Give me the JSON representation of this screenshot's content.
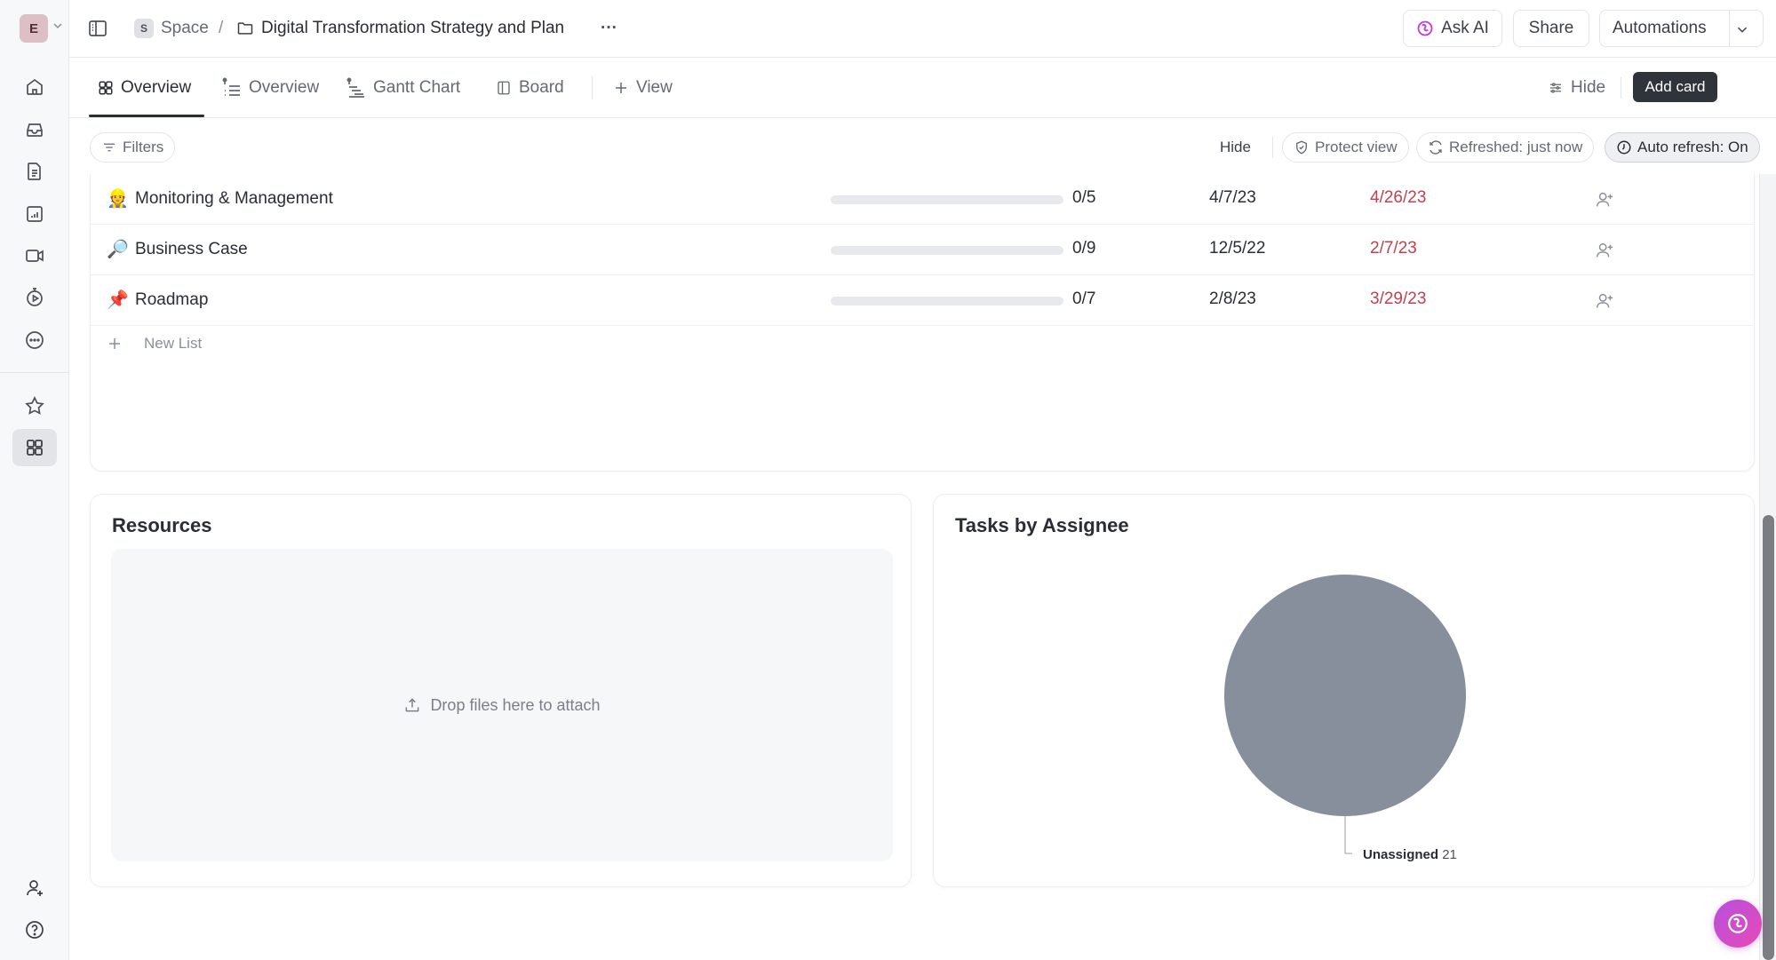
{
  "workspace": {
    "initial": "E"
  },
  "breadcrumb": {
    "space_badge": "S",
    "space": "Space",
    "separator": "/",
    "folder": "Digital Transformation Strategy and Plan",
    "more": "···"
  },
  "header_buttons": {
    "ask_ai": "Ask AI",
    "share": "Share",
    "automations": "Automations"
  },
  "tabs": [
    {
      "label": "Overview",
      "icon": "dashboard-grid-icon",
      "active": true
    },
    {
      "label": "Overview",
      "icon": "pinned-list-icon",
      "active": false
    },
    {
      "label": "Gantt Chart",
      "icon": "pinned-gantt-icon",
      "active": false
    },
    {
      "label": "Board",
      "icon": "board-icon",
      "active": false
    }
  ],
  "add_view_label": "View",
  "tabbar_actions": {
    "hide": "Hide",
    "add_card": "Add card"
  },
  "filters": {
    "filters_label": "Filters",
    "hide_label": "Hide",
    "protect_view": "Protect view",
    "refreshed": "Refreshed: just now",
    "auto_refresh": "Auto refresh: On"
  },
  "lists": [
    {
      "emoji": "👷",
      "name": "Monitoring & Management",
      "done": 0,
      "total": 5,
      "progress_label": "0/5",
      "start": "4/7/23",
      "due": "4/26/23"
    },
    {
      "emoji": "🔎",
      "name": "Business Case",
      "done": 0,
      "total": 9,
      "progress_label": "0/9",
      "start": "12/5/22",
      "due": "2/7/23"
    },
    {
      "emoji": "📌",
      "name": "Roadmap",
      "done": 0,
      "total": 7,
      "progress_label": "0/7",
      "start": "2/8/23",
      "due": "3/29/23"
    }
  ],
  "new_list_label": "New List",
  "resources": {
    "title": "Resources",
    "drop_text": "Drop files here to attach"
  },
  "tasks_by_assignee": {
    "title": "Tasks by Assignee"
  },
  "chart_data": {
    "type": "pie",
    "title": "Tasks by Assignee",
    "labels": [
      "Unassigned"
    ],
    "values": [
      21
    ],
    "colors": [
      "#878f9c"
    ],
    "legend": "none",
    "data_labels": [
      {
        "label": "Unassigned",
        "value": "21"
      }
    ]
  },
  "colors": {
    "due_overdue": "#c2404f",
    "accent_dark": "#2a2e34",
    "fab_gradient_start": "#b84fe0",
    "fab_gradient_end": "#e64bb4"
  }
}
